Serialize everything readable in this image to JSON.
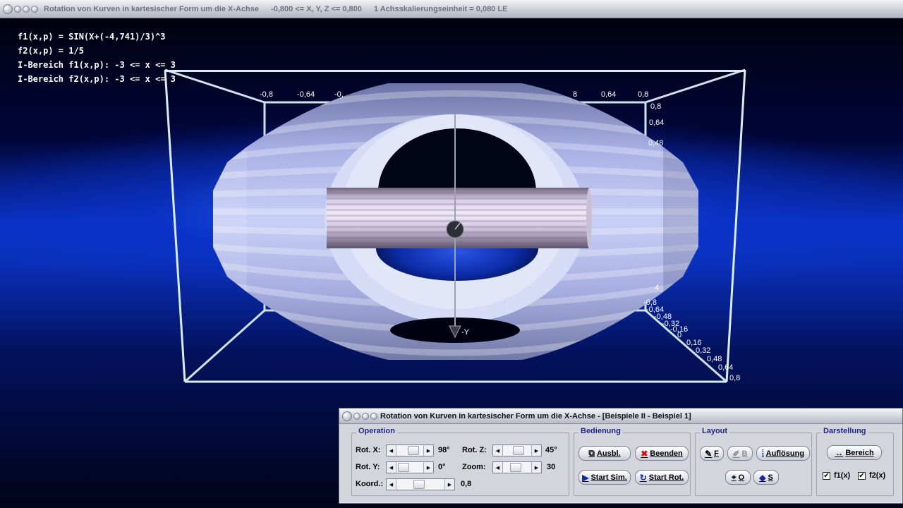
{
  "main_window": {
    "title": "Rotation von Kurven in kartesischer Form um die X-Achse",
    "range": "-0,800 <= X, Y, Z <= 0,800",
    "scale": "1 Achsskalierungseinheit = 0,080 LE"
  },
  "info": {
    "f1": "f1(x,p) = SIN(X+(-4,741)/3)^3",
    "f2": "f2(x,p) = 1/5",
    "range_f1": "I-Bereich f1(x,p): -3 <= x <= 3",
    "range_f2": "I-Bereich f2(x,p): -3 <= x <= 3"
  },
  "axes": {
    "top_ticks": [
      "-0,8",
      "-0,64",
      "-0,",
      "8",
      "0,64",
      "0,8"
    ],
    "right_ticks": [
      "0,8",
      "0,64",
      "0,48",
      "4"
    ],
    "lower_ticks": [
      "-0,8",
      "-0,64",
      "-0,48",
      "-0,32",
      "-0,16",
      "0",
      "0,16",
      "0,32",
      "0,48",
      "0,64",
      "0,8"
    ],
    "y_label": "-Y"
  },
  "dialog": {
    "title": "Rotation von Kurven in kartesischer Form um die X-Achse - [Beispiele II - Beispiel 1]",
    "operation": {
      "title": "Operation",
      "rot_x_label": "Rot. X:",
      "rot_x_value": "98°",
      "rot_y_label": "Rot. Y:",
      "rot_y_value": "0°",
      "koord_label": "Koord.:",
      "koord_value": "0,8",
      "rot_z_label": "Rot. Z:",
      "rot_z_value": "45°",
      "zoom_label": "Zoom:",
      "zoom_value": "30"
    },
    "bedienung": {
      "title": "Bedienung",
      "ausbl": "Ausbl.",
      "beenden": "Beenden",
      "start_sim": "Start Sim.",
      "start_rot": "Start Rot."
    },
    "layout": {
      "title": "Layout",
      "f": "F",
      "b": "B",
      "aufloesung": "Auflösung",
      "o": "O",
      "s": "S"
    },
    "darstellung": {
      "title": "Darstellung",
      "bereich": "Bereich",
      "f1": "f1(x)",
      "f1_checked": true,
      "f2": "f2(x)",
      "f2_checked": true
    }
  }
}
